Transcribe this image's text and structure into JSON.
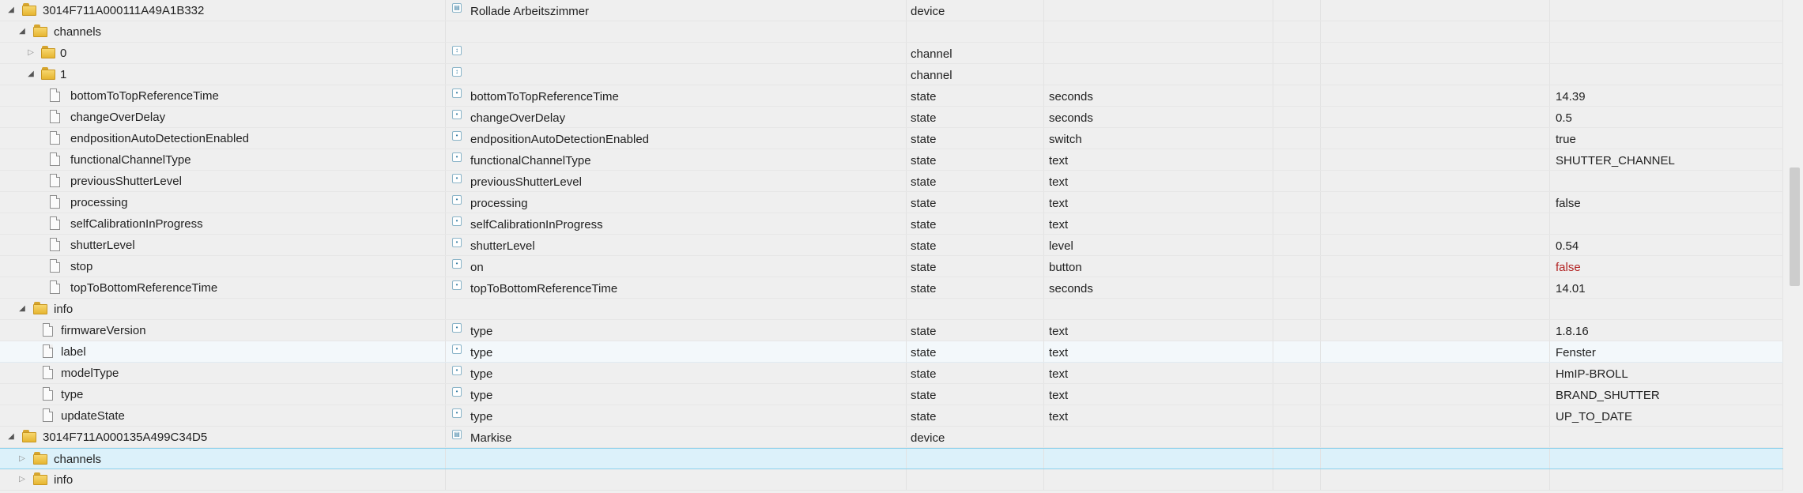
{
  "rows": [
    {
      "name": "3014F711A000111A49A1B332",
      "level": 0,
      "node": "folder",
      "expanded": true,
      "type_icon": "device-icon",
      "display": "Rollade Arbeitszimmer",
      "kind": "device",
      "unit": "",
      "value": ""
    },
    {
      "name": "channels",
      "level": 1,
      "node": "folder",
      "expanded": true,
      "type_icon": "",
      "display": "",
      "kind": "",
      "unit": "",
      "value": ""
    },
    {
      "name": "0",
      "level": 2,
      "node": "folder",
      "expanded": false,
      "type_icon": "channel-icon",
      "display": "",
      "kind": "channel",
      "unit": "",
      "value": ""
    },
    {
      "name": "1",
      "level": 2,
      "node": "folder",
      "expanded": true,
      "type_icon": "channel-icon",
      "display": "",
      "kind": "channel",
      "unit": "",
      "value": ""
    },
    {
      "name": "bottomToTopReferenceTime",
      "level": 3,
      "node": "file",
      "type_icon": "state-icon",
      "display": "bottomToTopReferenceTime",
      "kind": "state",
      "unit": "seconds",
      "value": "14.39"
    },
    {
      "name": "changeOverDelay",
      "level": 3,
      "node": "file",
      "type_icon": "state-icon",
      "display": "changeOverDelay",
      "kind": "state",
      "unit": "seconds",
      "value": "0.5"
    },
    {
      "name": "endpositionAutoDetectionEnabled",
      "level": 3,
      "node": "file",
      "type_icon": "state-icon",
      "display": "endpositionAutoDetectionEnabled",
      "kind": "state",
      "unit": "switch",
      "value": "true"
    },
    {
      "name": "functionalChannelType",
      "level": 3,
      "node": "file",
      "type_icon": "state-icon",
      "display": "functionalChannelType",
      "kind": "state",
      "unit": "text",
      "value": "SHUTTER_CHANNEL"
    },
    {
      "name": "previousShutterLevel",
      "level": 3,
      "node": "file",
      "type_icon": "state-icon",
      "display": "previousShutterLevel",
      "kind": "state",
      "unit": "text",
      "value": ""
    },
    {
      "name": "processing",
      "level": 3,
      "node": "file",
      "type_icon": "state-icon",
      "display": "processing",
      "kind": "state",
      "unit": "text",
      "value": "false"
    },
    {
      "name": "selfCalibrationInProgress",
      "level": 3,
      "node": "file",
      "type_icon": "state-icon",
      "display": "selfCalibrationInProgress",
      "kind": "state",
      "unit": "text",
      "value": ""
    },
    {
      "name": "shutterLevel",
      "level": 3,
      "node": "file",
      "type_icon": "state-icon",
      "display": "shutterLevel",
      "kind": "state",
      "unit": "level",
      "value": "0.54"
    },
    {
      "name": "stop",
      "level": 3,
      "node": "file",
      "type_icon": "state-icon",
      "display": "on",
      "kind": "state",
      "unit": "button",
      "value": "false",
      "value_color": "#b22222"
    },
    {
      "name": "topToBottomReferenceTime",
      "level": 3,
      "node": "file",
      "type_icon": "state-icon",
      "display": "topToBottomReferenceTime",
      "kind": "state",
      "unit": "seconds",
      "value": "14.01"
    },
    {
      "name": "info",
      "level": 1,
      "node": "folder",
      "expanded": true,
      "type_icon": "",
      "display": "",
      "kind": "",
      "unit": "",
      "value": ""
    },
    {
      "name": "firmwareVersion",
      "level": 2,
      "node": "file",
      "type_icon": "state-icon",
      "display": "type",
      "kind": "state",
      "unit": "text",
      "value": "1.8.16"
    },
    {
      "name": "label",
      "level": 2,
      "node": "file",
      "type_icon": "state-icon",
      "display": "type",
      "kind": "state",
      "unit": "text",
      "value": "Fenster",
      "highlight": "hover"
    },
    {
      "name": "modelType",
      "level": 2,
      "node": "file",
      "type_icon": "state-icon",
      "display": "type",
      "kind": "state",
      "unit": "text",
      "value": "HmIP-BROLL"
    },
    {
      "name": "type",
      "level": 2,
      "node": "file",
      "type_icon": "state-icon",
      "display": "type",
      "kind": "state",
      "unit": "text",
      "value": "BRAND_SHUTTER"
    },
    {
      "name": "updateState",
      "level": 2,
      "node": "file",
      "type_icon": "state-icon",
      "display": "type",
      "kind": "state",
      "unit": "text",
      "value": "UP_TO_DATE"
    },
    {
      "name": "3014F711A000135A499C34D5",
      "level": 0,
      "node": "folder",
      "expanded": true,
      "type_icon": "device-icon",
      "display": "Markise",
      "kind": "device",
      "unit": "",
      "value": ""
    },
    {
      "name": "channels",
      "level": 1,
      "node": "folder",
      "expanded": false,
      "type_icon": "",
      "display": "",
      "kind": "",
      "unit": "",
      "value": "",
      "highlight": "selected"
    },
    {
      "name": "info",
      "level": 1,
      "node": "folder",
      "expanded": false,
      "type_icon": "",
      "display": "",
      "kind": "",
      "unit": "",
      "value": ""
    }
  ]
}
